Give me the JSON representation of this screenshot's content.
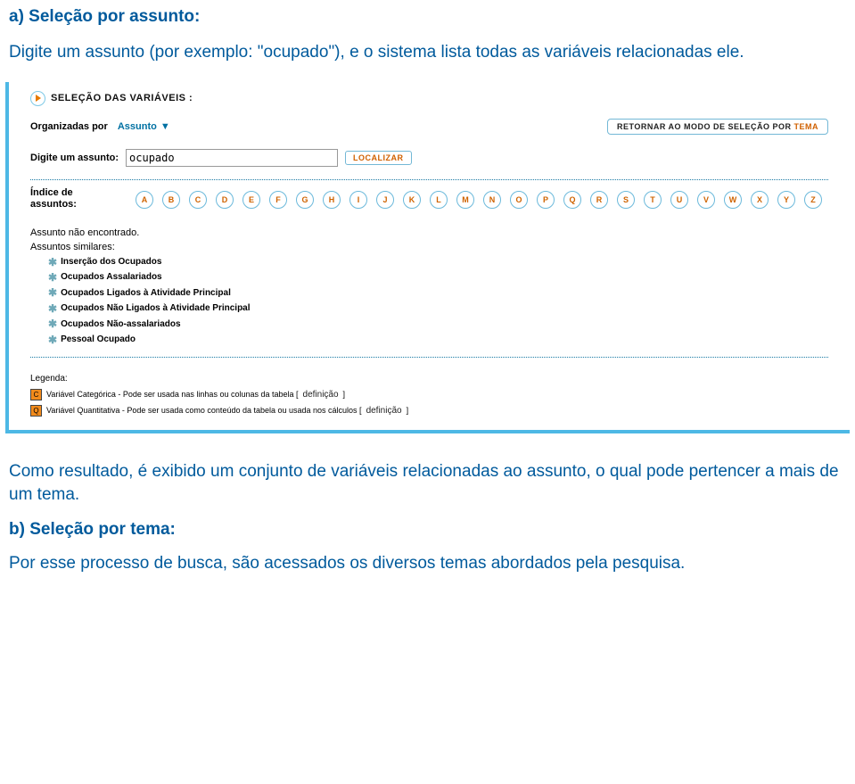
{
  "intro": {
    "heading": "a) Seleção por assunto:",
    "text": "Digite um assunto (por exemplo: \"ocupado\"), e o sistema lista todas as variáveis relacionadas ele."
  },
  "panel": {
    "section_title": "SELEÇÃO DAS VARIÁVEIS :",
    "organized_label": "Organizadas por",
    "organized_mode": "Assunto",
    "return_btn_prefix": "RETORNAR AO MODO DE SELEÇÃO POR ",
    "return_btn_accent": "TEMA",
    "search_label": "Digite um assunto:",
    "search_value": "ocupado",
    "locate_btn": "LOCALIZAR",
    "index_label": "Índice de assuntos:",
    "letters": [
      "A",
      "B",
      "C",
      "D",
      "E",
      "F",
      "G",
      "H",
      "I",
      "J",
      "K",
      "L",
      "M",
      "N",
      "O",
      "P",
      "Q",
      "R",
      "S",
      "T",
      "U",
      "V",
      "W",
      "X",
      "Y",
      "Z"
    ],
    "not_found": "Assunto não encontrado.",
    "similar_label": "Assuntos similares:",
    "similar_items": [
      "Inserção dos Ocupados",
      "Ocupados Assalariados",
      "Ocupados Ligados à Atividade Principal",
      "Ocupados Não Ligados à Atividade Principal",
      "Ocupados Não-assalariados",
      "Pessoal Ocupado"
    ],
    "legend_title": "Legenda:",
    "legend_c": "Variável Categórica - Pode ser usada nas linhas ou colunas da tabela [",
    "legend_q": "Variável Quantitativa - Pode ser usada como conteúdo da tabela ou usada nos cálculos [",
    "def_link": "definição",
    "bracket_close": "]"
  },
  "outro": {
    "result_text": "Como resultado, é exibido um conjunto de variáveis relacionadas  ao assunto, o qual pode pertencer a mais de um tema.",
    "heading": "b) Seleção por tema:",
    "text": "Por esse processo de busca, são acessados os diversos temas abordados pela pesquisa."
  }
}
